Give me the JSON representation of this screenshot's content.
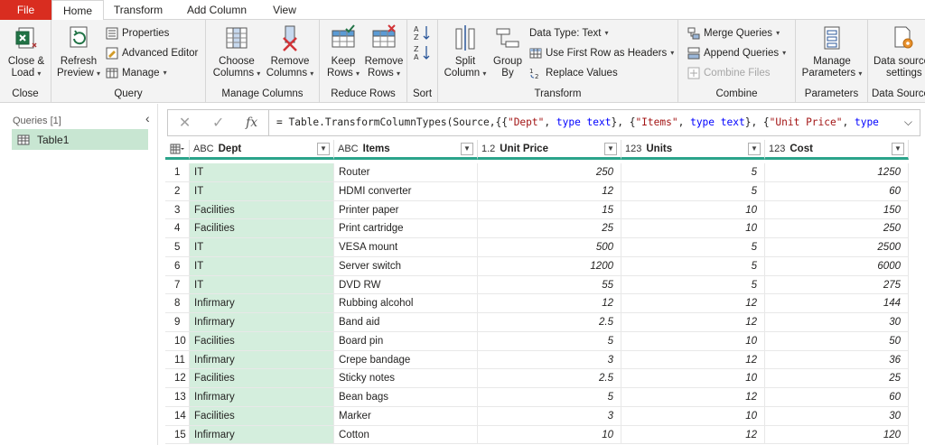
{
  "tabs": {
    "file": "File",
    "home": "Home",
    "transform": "Transform",
    "add_column": "Add Column",
    "view": "View"
  },
  "ribbon": {
    "close_group": {
      "label": "Close",
      "close_load_line1": "Close &",
      "close_load_line2": "Load"
    },
    "query_group": {
      "label": "Query",
      "refresh_line1": "Refresh",
      "refresh_line2": "Preview",
      "properties": "Properties",
      "advanced_editor": "Advanced Editor",
      "manage": "Manage"
    },
    "manage_columns_group": {
      "label": "Manage Columns",
      "choose_line1": "Choose",
      "choose_line2": "Columns",
      "remove_line1": "Remove",
      "remove_line2": "Columns"
    },
    "reduce_rows_group": {
      "label": "Reduce Rows",
      "keep_line1": "Keep",
      "keep_line2": "Rows",
      "remove_line1": "Remove",
      "remove_line2": "Rows"
    },
    "sort_group": {
      "label": "Sort"
    },
    "transform_group": {
      "label": "Transform",
      "split_line1": "Split",
      "split_line2": "Column",
      "group_line1": "Group",
      "group_line2": "By",
      "data_type": "Data Type: Text",
      "first_row_headers": "Use First Row as Headers",
      "replace_values": "Replace Values"
    },
    "combine_group": {
      "label": "Combine",
      "merge_queries": "Merge Queries",
      "append_queries": "Append Queries",
      "combine_files": "Combine Files"
    },
    "parameters_group": {
      "label": "Parameters",
      "manage_line1": "Manage",
      "manage_line2": "Parameters"
    },
    "data_sources_group": {
      "label": "Data Sources",
      "line1": "Data source",
      "line2": "settings"
    }
  },
  "queries_pane": {
    "header": "Queries [1]",
    "items": [
      "Table1"
    ]
  },
  "formula_bar": {
    "prefix": "= Table.TransformColumnTypes(Source,{{",
    "s1": "\"Dept\"",
    "sep1": ", ",
    "k1": "type text",
    "mid1": "}, {",
    "s2": "\"Items\"",
    "sep2": ", ",
    "k2": "type text",
    "mid2": "}, {",
    "s3": "\"Unit Price\"",
    "sep3": ", ",
    "k3": "type"
  },
  "table": {
    "columns": [
      {
        "type_icon": "ABC",
        "name": "Dept"
      },
      {
        "type_icon": "ABC",
        "name": "Items"
      },
      {
        "type_icon": "1.2",
        "name": "Unit Price"
      },
      {
        "type_icon": "123",
        "name": "Units"
      },
      {
        "type_icon": "123",
        "name": "Cost"
      }
    ],
    "rows": [
      {
        "i": "1",
        "dept": "IT",
        "item": "Router",
        "price": "250",
        "units": "5",
        "cost": "1250"
      },
      {
        "i": "2",
        "dept": "IT",
        "item": "HDMI converter",
        "price": "12",
        "units": "5",
        "cost": "60"
      },
      {
        "i": "3",
        "dept": "Facilities",
        "item": "Printer paper",
        "price": "15",
        "units": "10",
        "cost": "150"
      },
      {
        "i": "4",
        "dept": "Facilities",
        "item": "Print cartridge",
        "price": "25",
        "units": "10",
        "cost": "250"
      },
      {
        "i": "5",
        "dept": "IT",
        "item": "VESA mount",
        "price": "500",
        "units": "5",
        "cost": "2500"
      },
      {
        "i": "6",
        "dept": "IT",
        "item": "Server switch",
        "price": "1200",
        "units": "5",
        "cost": "6000"
      },
      {
        "i": "7",
        "dept": "IT",
        "item": "DVD RW",
        "price": "55",
        "units": "5",
        "cost": "275"
      },
      {
        "i": "8",
        "dept": "Infirmary",
        "item": "Rubbing alcohol",
        "price": "12",
        "units": "12",
        "cost": "144"
      },
      {
        "i": "9",
        "dept": "Infirmary",
        "item": "Band aid",
        "price": "2.5",
        "units": "12",
        "cost": "30"
      },
      {
        "i": "10",
        "dept": "Facilities",
        "item": "Board pin",
        "price": "5",
        "units": "10",
        "cost": "50"
      },
      {
        "i": "11",
        "dept": "Infirmary",
        "item": "Crepe bandage",
        "price": "3",
        "units": "12",
        "cost": "36"
      },
      {
        "i": "12",
        "dept": "Facilities",
        "item": "Sticky notes",
        "price": "2.5",
        "units": "10",
        "cost": "25"
      },
      {
        "i": "13",
        "dept": "Infirmary",
        "item": "Bean bags",
        "price": "5",
        "units": "12",
        "cost": "60"
      },
      {
        "i": "14",
        "dept": "Facilities",
        "item": "Marker",
        "price": "3",
        "units": "10",
        "cost": "30"
      },
      {
        "i": "15",
        "dept": "Infirmary",
        "item": "Cotton",
        "price": "10",
        "units": "12",
        "cost": "120"
      }
    ]
  },
  "colors": {
    "file_tab": "#d92d20",
    "selected_column": "#d4eedd",
    "query_selected": "#c8e6d2",
    "header_underline": "#2ba48b"
  }
}
